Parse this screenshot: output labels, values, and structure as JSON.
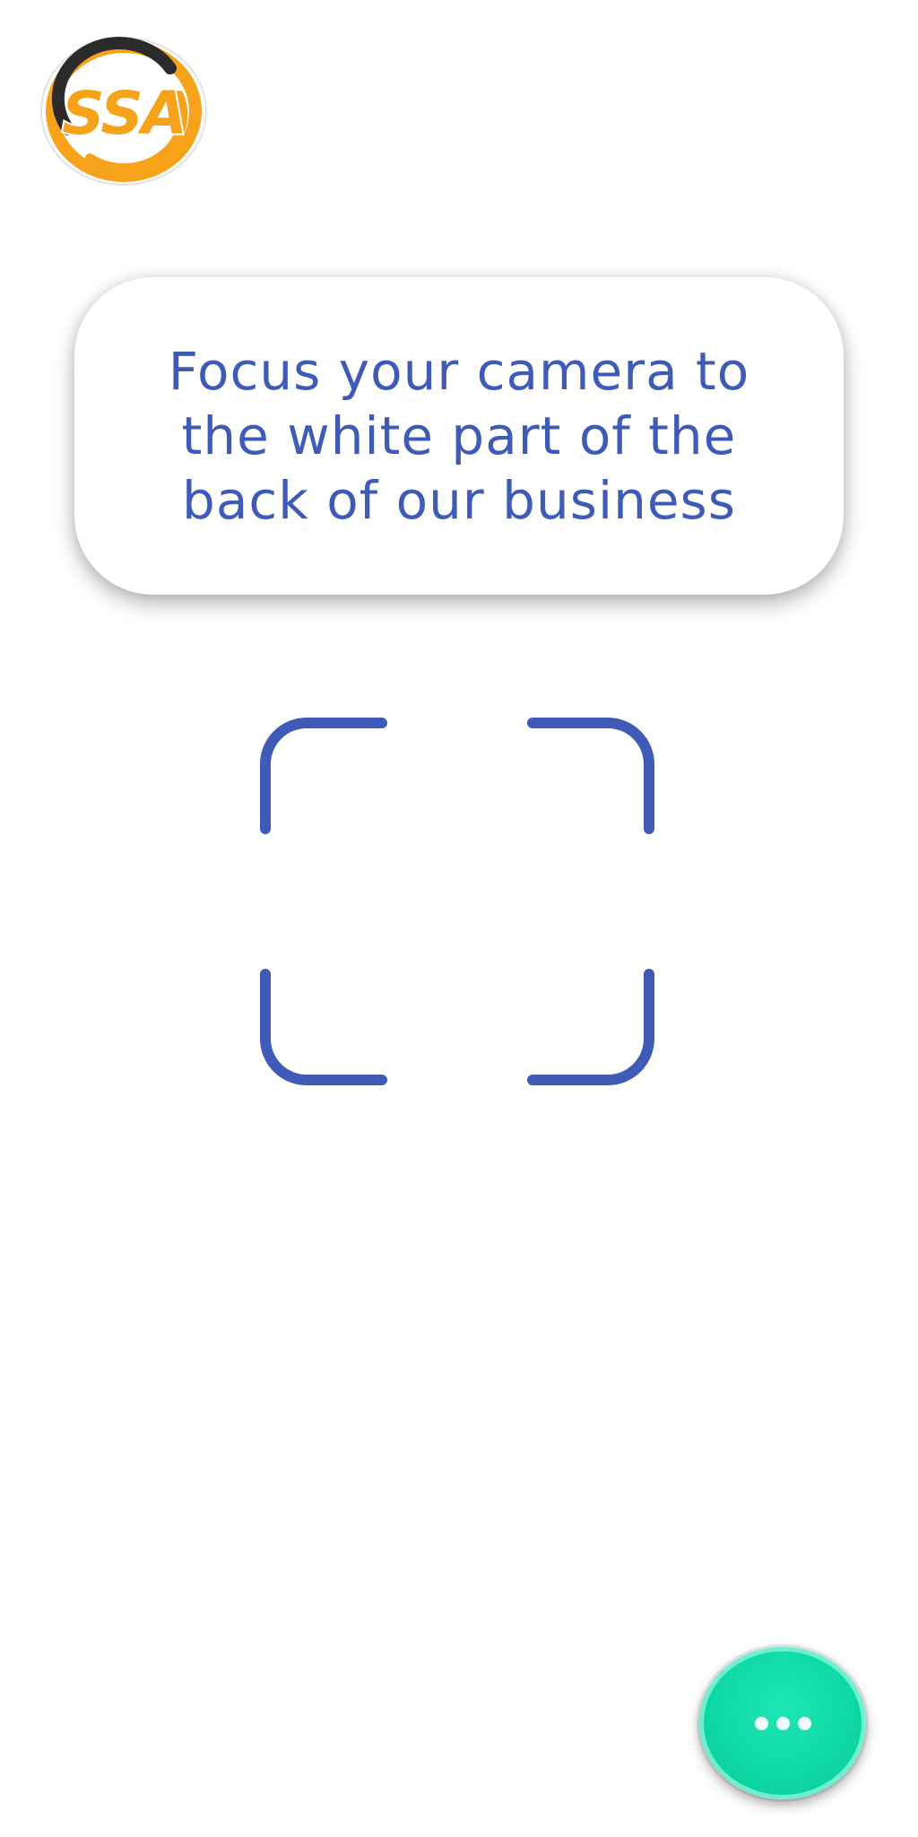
{
  "logo": {
    "text": "SSA",
    "icon": "ssa-logo-icon",
    "colors": {
      "orange": "#f7a21b",
      "ring_dark": "#2b2b2b",
      "outline": "#ffffff"
    }
  },
  "instruction": {
    "line_1": "Focus your camera to",
    "line_2": "the white part of the",
    "line_3": "back of our business",
    "color": "#3f5bb8"
  },
  "scan_frame": {
    "icon": "scan-frame-icon",
    "color": "#3f5bb8"
  },
  "fab": {
    "icon": "more-dots-icon",
    "color": "#0fd9a6"
  }
}
